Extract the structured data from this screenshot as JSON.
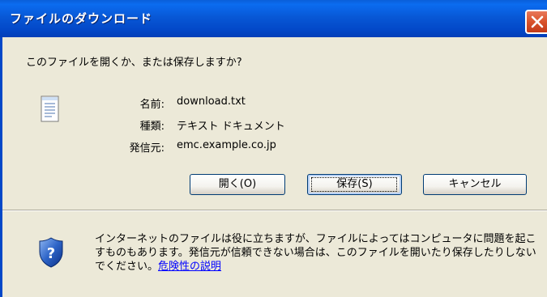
{
  "window": {
    "title": "ファイルのダウンロード",
    "close_icon": "close-icon"
  },
  "dialog": {
    "prompt": "このファイルを開くか、または保存しますか?",
    "file_icon": "text-document-icon",
    "fields": {
      "name_label": "名前:",
      "name_value": "download.txt",
      "type_label": "種類:",
      "type_value": "テキスト ドキュメント",
      "source_label": "発信元:",
      "source_value": "emc.example.co.jp"
    },
    "buttons": {
      "open_label": "開く(O)",
      "save_label": "保存(S)",
      "cancel_label": "キャンセル"
    },
    "warning": {
      "icon": "shield-question-icon",
      "text": "インターネットのファイルは役に立ちますが、ファイルによってはコンピュータに問題を起こすものもあります。発信元が信頼できない場合は、このファイルを開いたり保存したりしないでください。",
      "link_label": "危険性の説明"
    }
  },
  "colors": {
    "titlebar": "#0858d6",
    "dialog_bg": "#ece9d8",
    "close_button": "#d9532b",
    "link": "#0000ff"
  }
}
